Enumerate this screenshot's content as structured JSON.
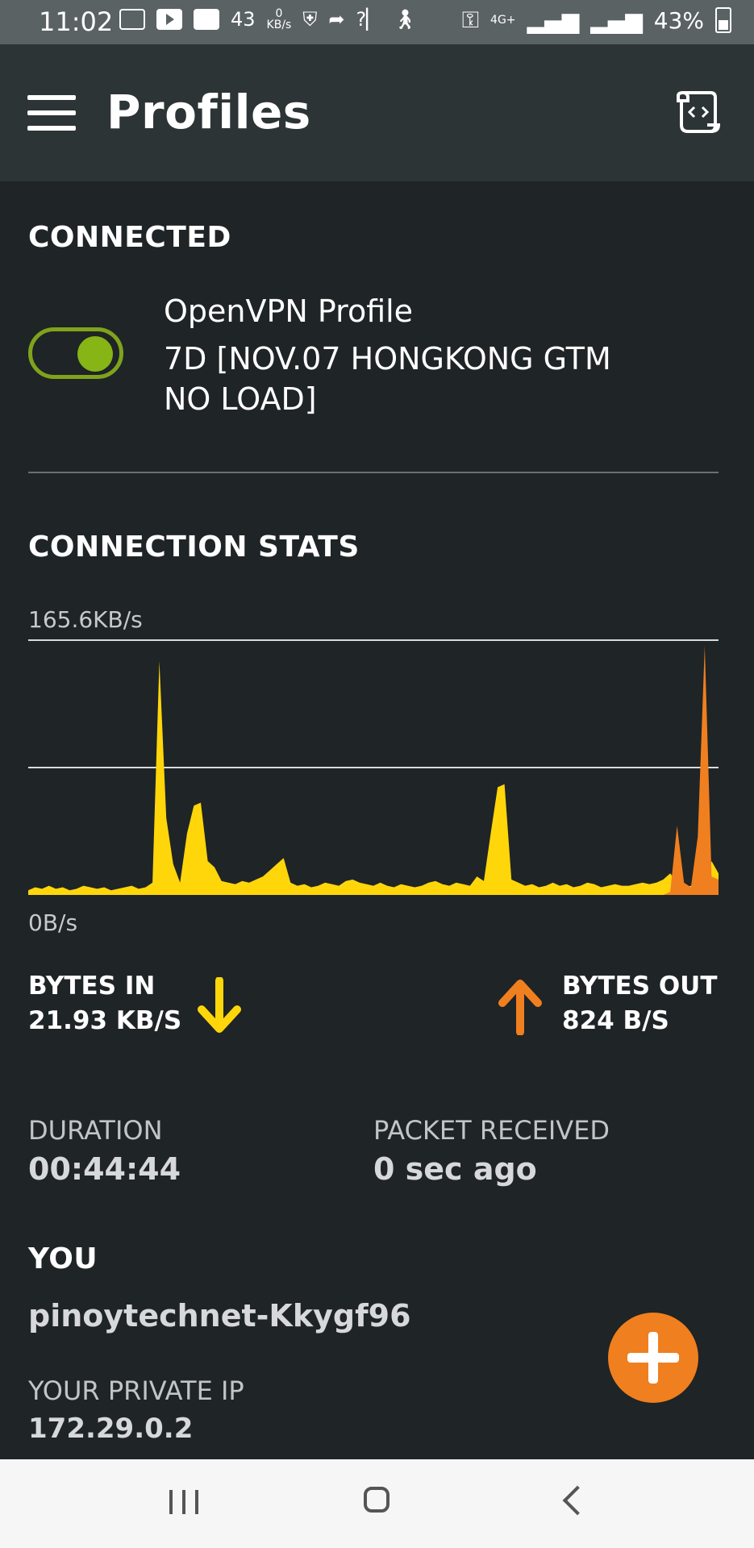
{
  "status_bar": {
    "time": "11:02",
    "network_count": "43",
    "speed_value": "0",
    "speed_unit": "KB/s",
    "battery_percent": "43%",
    "network_type": "4G+"
  },
  "app_bar": {
    "title": "Profiles"
  },
  "connected": {
    "heading": "CONNECTED",
    "toggle_on": true,
    "profile_name": "OpenVPN Profile",
    "profile_description": "7D [NOV.07 HONGKONG GTM NO LOAD]"
  },
  "stats": {
    "heading": "CONNECTION STATS",
    "max_label": "165.6KB/s",
    "min_label": "0B/s",
    "bytes_in_label": "BYTES IN",
    "bytes_in_value": "21.93 KB/S",
    "bytes_out_label": "BYTES OUT",
    "bytes_out_value": "824 B/S",
    "duration_label": "DURATION",
    "duration_value": "00:44:44",
    "packet_label": "PACKET RECEIVED",
    "packet_value": "0 sec ago"
  },
  "you": {
    "heading": "YOU",
    "username": "pinoytechnet-Kkygf96",
    "private_ip_label": "YOUR PRIVATE IP",
    "private_ip": "172.29.0.2"
  },
  "chart_data": {
    "type": "area",
    "ylim": [
      0,
      165.6
    ],
    "y_unit": "KB/s",
    "series": [
      {
        "color": "#ffd60a",
        "values": [
          3,
          5,
          4,
          6,
          4,
          5,
          3,
          4,
          6,
          5,
          4,
          5,
          3,
          4,
          5,
          6,
          4,
          5,
          8,
          152,
          50,
          20,
          8,
          40,
          58,
          60,
          22,
          18,
          9,
          8,
          7,
          9,
          8,
          10,
          12,
          16,
          20,
          24,
          8,
          6,
          7,
          5,
          6,
          8,
          7,
          6,
          9,
          10,
          8,
          7,
          6,
          8,
          6,
          5,
          7,
          6,
          5,
          6,
          8,
          9,
          7,
          6,
          8,
          7,
          6,
          12,
          9,
          40,
          70,
          72,
          10,
          8,
          6,
          7,
          5,
          6,
          8,
          6,
          7,
          5,
          6,
          8,
          7,
          5,
          6,
          7,
          6,
          6,
          7,
          8,
          7,
          8,
          10,
          14,
          8,
          5,
          6,
          5,
          5,
          22,
          14
        ]
      },
      {
        "color": "#f07f1f",
        "values": [
          0,
          0,
          0,
          0,
          0,
          0,
          0,
          0,
          0,
          0,
          0,
          0,
          0,
          0,
          0,
          0,
          0,
          0,
          0,
          0,
          0,
          0,
          0,
          0,
          0,
          0,
          0,
          0,
          0,
          0,
          0,
          0,
          0,
          0,
          0,
          0,
          0,
          0,
          0,
          0,
          0,
          0,
          0,
          0,
          0,
          0,
          0,
          0,
          0,
          0,
          0,
          0,
          0,
          0,
          0,
          0,
          0,
          0,
          0,
          0,
          0,
          0,
          0,
          0,
          0,
          0,
          0,
          0,
          0,
          0,
          0,
          0,
          0,
          0,
          0,
          0,
          0,
          0,
          0,
          0,
          0,
          0,
          0,
          0,
          0,
          0,
          0,
          0,
          0,
          0,
          0,
          0,
          0,
          2,
          45,
          8,
          5,
          38,
          162,
          12,
          10
        ]
      }
    ]
  },
  "colors": {
    "background": "#1f2426",
    "app_bar": "#2d3436",
    "accent_green": "#86b515",
    "bytes_in_yellow": "#ffd60a",
    "bytes_out_orange": "#f07f1f"
  },
  "icons": {
    "menu": "hamburger-icon",
    "log": "log-file-icon",
    "down_arrow": "arrow-down-icon",
    "up_arrow": "arrow-up-icon",
    "add": "plus-icon"
  }
}
